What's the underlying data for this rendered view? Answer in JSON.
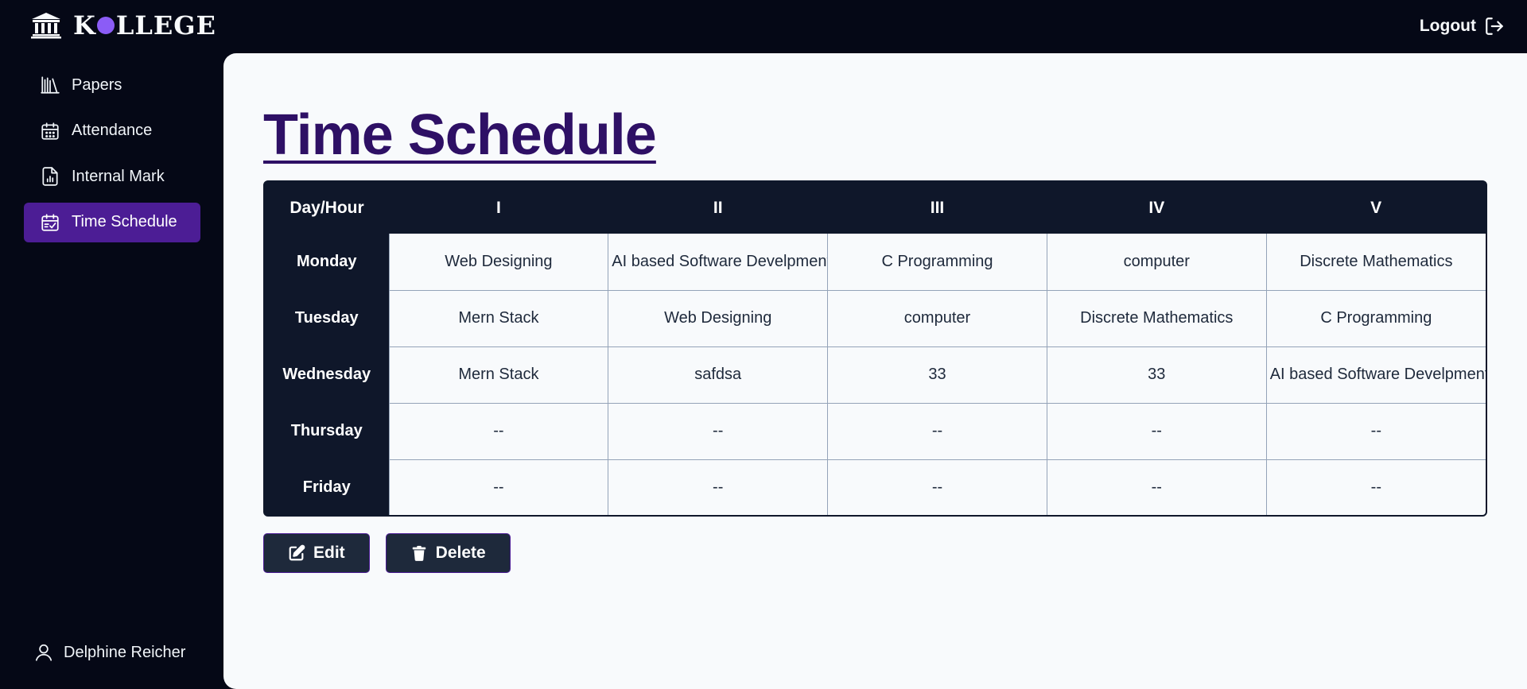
{
  "brand": {
    "name_start": "K",
    "name_end": "LLEGE"
  },
  "header": {
    "logout_label": "Logout"
  },
  "sidebar": {
    "items": [
      {
        "label": "Papers",
        "icon": "books-icon"
      },
      {
        "label": "Attendance",
        "icon": "calendar-icon"
      },
      {
        "label": "Internal Mark",
        "icon": "report-icon"
      },
      {
        "label": "Time Schedule",
        "icon": "calendar-check-icon",
        "active": true
      }
    ],
    "user_name": "Delphine Reicher"
  },
  "main": {
    "title": "Time Schedule",
    "table": {
      "corner": "Day/Hour",
      "hours": [
        "I",
        "II",
        "III",
        "IV",
        "V"
      ],
      "rows": [
        {
          "day": "Monday",
          "cells": [
            "Web Designing",
            "AI based Software Develpment",
            "C Programming",
            "computer",
            "Discrete Mathematics"
          ]
        },
        {
          "day": "Tuesday",
          "cells": [
            "Mern Stack",
            "Web Designing",
            "computer",
            "Discrete Mathematics",
            "C Programming"
          ]
        },
        {
          "day": "Wednesday",
          "cells": [
            "Mern Stack",
            "safdsa",
            "33",
            "33",
            "AI based Software Develpment"
          ]
        },
        {
          "day": "Thursday",
          "cells": [
            "--",
            "--",
            "--",
            "--",
            "--"
          ]
        },
        {
          "day": "Friday",
          "cells": [
            "--",
            "--",
            "--",
            "--",
            "--"
          ]
        }
      ]
    },
    "actions": {
      "edit_label": "Edit",
      "delete_label": "Delete"
    }
  },
  "colors": {
    "background": "#050816",
    "accent": "#4c1d95",
    "title": "#2e1065",
    "brand_dot": "#8b5cf6",
    "table_dark": "#0f172a"
  }
}
